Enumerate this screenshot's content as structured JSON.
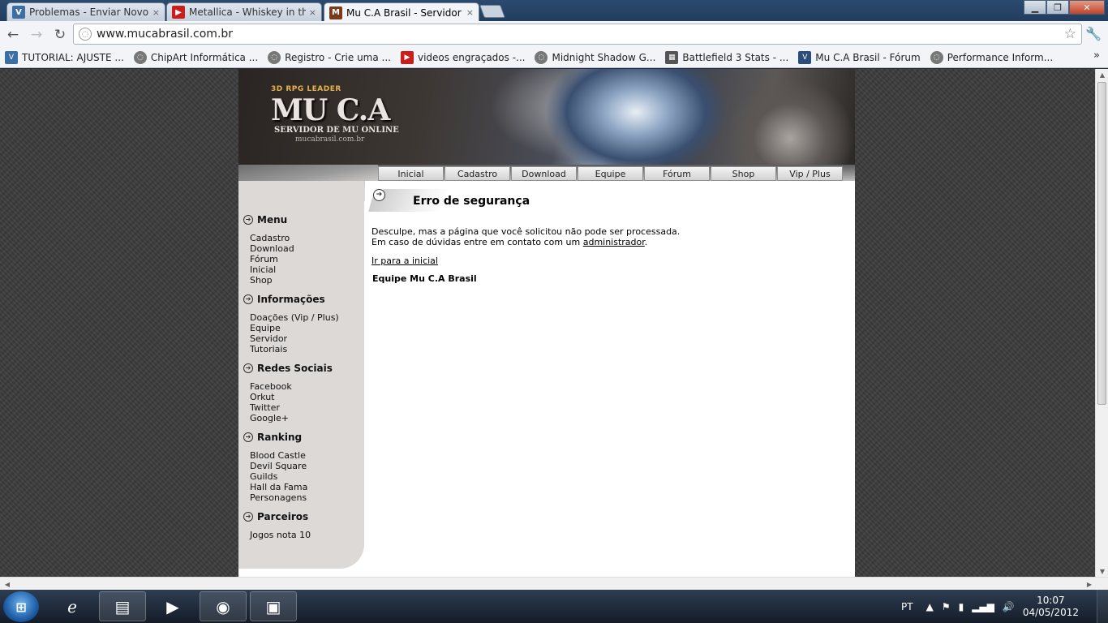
{
  "browser": {
    "tabs": [
      {
        "title": "Problemas - Enviar Novo Tó",
        "favicon": "V",
        "favicon_color": "#3a6ea5"
      },
      {
        "title": "Metallica - Whiskey in the ja",
        "favicon": "▶",
        "favicon_color": "#cc1d1d"
      },
      {
        "title": "Mu C.A Brasil - Servidor Bra",
        "favicon": "M",
        "favicon_color": "#7a3b1c"
      }
    ],
    "close_glyph": "×",
    "url": "www.mucabrasil.com.br",
    "bookmarks": [
      {
        "label": "TUTORIAL: AJUSTE ...",
        "icon_color": "#3a6ea5"
      },
      {
        "label": "ChipArt Informática ...",
        "icon_color": "#777"
      },
      {
        "label": "Registro - Crie uma ...",
        "icon_color": "#777"
      },
      {
        "label": "videos engraçados -...",
        "icon_color": "#cc1d1d"
      },
      {
        "label": "Midnight Shadow G...",
        "icon_color": "#777"
      },
      {
        "label": "Battlefield 3 Stats - ...",
        "icon_color": "#555"
      },
      {
        "label": "Mu C.A Brasil - Fórum",
        "icon_color": "#2a4d7a"
      },
      {
        "label": "Performance Inform...",
        "icon_color": "#777"
      }
    ]
  },
  "site": {
    "brand": {
      "tagline": "3D RPG LEADER",
      "logo": "MU C.A",
      "subtitle": "SERVIDOR DE MU ONLINE",
      "domain": "mucabrasil.com.br"
    },
    "topnav": [
      "Inicial",
      "Cadastro",
      "Download",
      "Equipe",
      "Fórum",
      "Shop",
      "Vip / Plus"
    ],
    "sidebar": [
      {
        "title": "Menu",
        "links": [
          "Cadastro",
          "Download",
          "Fórum",
          "Inicial",
          "Shop"
        ]
      },
      {
        "title": "Informações",
        "links": [
          "Doações (Vip / Plus)",
          "Equipe",
          "Servidor",
          "Tutoriais"
        ]
      },
      {
        "title": "Redes Sociais",
        "links": [
          "Facebook",
          "Orkut",
          "Twitter",
          "Google+"
        ]
      },
      {
        "title": "Ranking",
        "links": [
          "Blood Castle",
          "Devil Square",
          "Guilds",
          "Hall da Fama",
          "Personagens"
        ]
      },
      {
        "title": "Parceiros",
        "links": [
          "Jogos nota 10"
        ]
      }
    ],
    "content": {
      "title": "Erro de segurança",
      "line1": "Desculpe, mas a página que você solicitou não pode ser processada.",
      "line2_prefix": "Em caso de dúvidas entre em contato com um ",
      "line2_link": "administrador",
      "line2_suffix": ".",
      "home_link": "Ir para a inicial",
      "signature": "Equipe Mu C.A Brasil"
    }
  },
  "taskbar": {
    "language": "PT",
    "time": "10:07",
    "date": "04/05/2012"
  }
}
